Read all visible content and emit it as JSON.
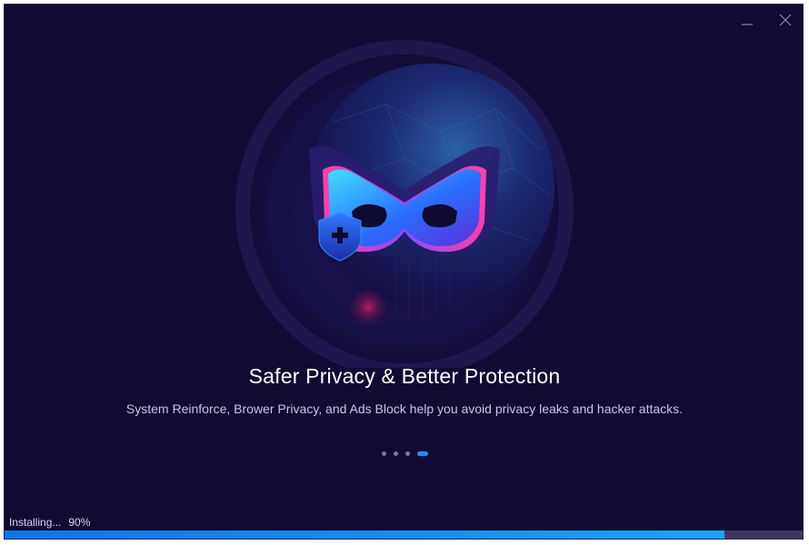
{
  "window": {
    "minimize_icon": "minimize-icon",
    "close_icon": "close-icon"
  },
  "hero": {
    "illustration": "privacy-mask-shield-illustration"
  },
  "slide": {
    "title": "Safer Privacy & Better Protection",
    "subtitle": "System Reinforce, Brower Privacy, and Ads Block help you avoid privacy leaks and hacker attacks.",
    "dots_count": 4,
    "active_dot": 4
  },
  "status": {
    "label": "Installing...",
    "percent_text": "90%",
    "progress": 0.9
  },
  "colors": {
    "background": "#110a33",
    "accent": "#1a8cff",
    "track": "#3f3660"
  }
}
